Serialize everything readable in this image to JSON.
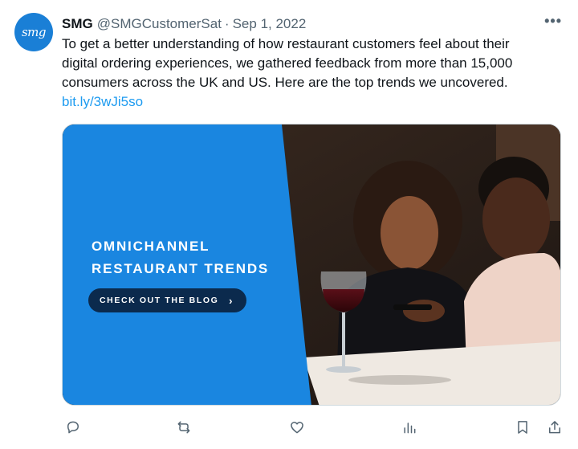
{
  "tweet": {
    "avatar_text": "smg",
    "author_name": "SMG",
    "author_handle": "@SMGCustomerSat",
    "separator": "·",
    "date": "Sep 1, 2022",
    "more_label": "•••",
    "text_lines": [
      "To get a better understanding of how restaurant customers feel about their",
      "digital ordering experiences, we gathered feedback from more than 15,000",
      "consumers across the UK and US. Here are the top trends we uncovered."
    ],
    "link": "bit.ly/3wJi5so"
  },
  "media": {
    "title_line1": "OMNICHANNEL",
    "title_line2": "RESTAURANT TRENDS",
    "cta_label": "CHECK OUT THE BLOG",
    "cta_chevron": "›",
    "panel_color": "#1a86e0",
    "cta_color": "#0b2a4d"
  },
  "actions": [
    {
      "name": "reply",
      "icon": "reply-icon"
    },
    {
      "name": "retweet",
      "icon": "retweet-icon"
    },
    {
      "name": "like",
      "icon": "heart-icon"
    },
    {
      "name": "views",
      "icon": "views-icon"
    },
    {
      "name": "bookmark",
      "icon": "bookmark-icon"
    },
    {
      "name": "share",
      "icon": "share-icon"
    }
  ]
}
